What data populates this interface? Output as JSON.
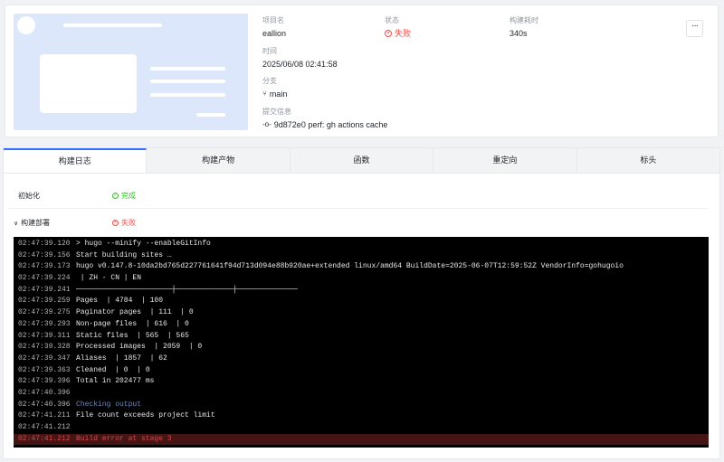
{
  "project": {
    "name_label": "项目名",
    "name": "eallion",
    "status_label": "状态",
    "status": "失败",
    "duration_label": "构建耗时",
    "duration": "340s",
    "time_label": "时间",
    "time": "2025/06/08 02:41:58",
    "branch_label": "分支",
    "branch": "main",
    "commit_label": "提交信息",
    "commit": "9d872e0 perf: gh actions cache",
    "more_label": "···"
  },
  "tabs": [
    {
      "label": "构建日志",
      "active": true
    },
    {
      "label": "构建产物"
    },
    {
      "label": "函数"
    },
    {
      "label": "重定向"
    },
    {
      "label": "标头"
    }
  ],
  "stages": [
    {
      "name": "初始化",
      "status": "完成"
    },
    {
      "name": "构建部署",
      "status": "失败"
    }
  ],
  "log": [
    {
      "ts": "02:47:39.120",
      "msg": "> hugo --minify --enableGitInfo"
    },
    {
      "ts": "02:47:39.156",
      "msg": "Start building sites …"
    },
    {
      "ts": "02:47:39.173",
      "msg": "hugo v0.147.8-10da2bd765d227761641f94d713d094e88b920ae+extended linux/amd64 BuildDate=2025-06-07T12:59:52Z VendorInfo=gohugoio"
    },
    {
      "ts": "02:47:39.224",
      "msg": " | ZH - CN | EN"
    },
    {
      "ts": "02:47:39.241",
      "msg": "──────────────────────┼─────────────┼──────────────"
    },
    {
      "ts": "02:47:39.259",
      "msg": "Pages  | 4784  | 100"
    },
    {
      "ts": "02:47:39.275",
      "msg": "Paginator pages  | 111  | 0"
    },
    {
      "ts": "02:47:39.293",
      "msg": "Non-page files  | 616  | 0"
    },
    {
      "ts": "02:47:39.311",
      "msg": "Static files  | 565  | 565"
    },
    {
      "ts": "02:47:39.328",
      "msg": "Processed images  | 2059  | 0"
    },
    {
      "ts": "02:47:39.347",
      "msg": "Aliases  | 1857  | 62"
    },
    {
      "ts": "02:47:39.363",
      "msg": "Cleaned  | 0  | 0"
    },
    {
      "ts": "02:47:39.396",
      "msg": "Total in 202477 ms"
    },
    {
      "ts": "02:47:40.396",
      "msg": ""
    },
    {
      "ts": "02:47:40.396",
      "msg": "Checking output",
      "kind": "dim"
    },
    {
      "ts": "02:47:41.211",
      "msg": "File count exceeds project limit"
    },
    {
      "ts": "02:47:41.212",
      "msg": ""
    },
    {
      "ts": "02:47:41.212",
      "msg": "Build error at stage 3",
      "kind": "err"
    }
  ]
}
